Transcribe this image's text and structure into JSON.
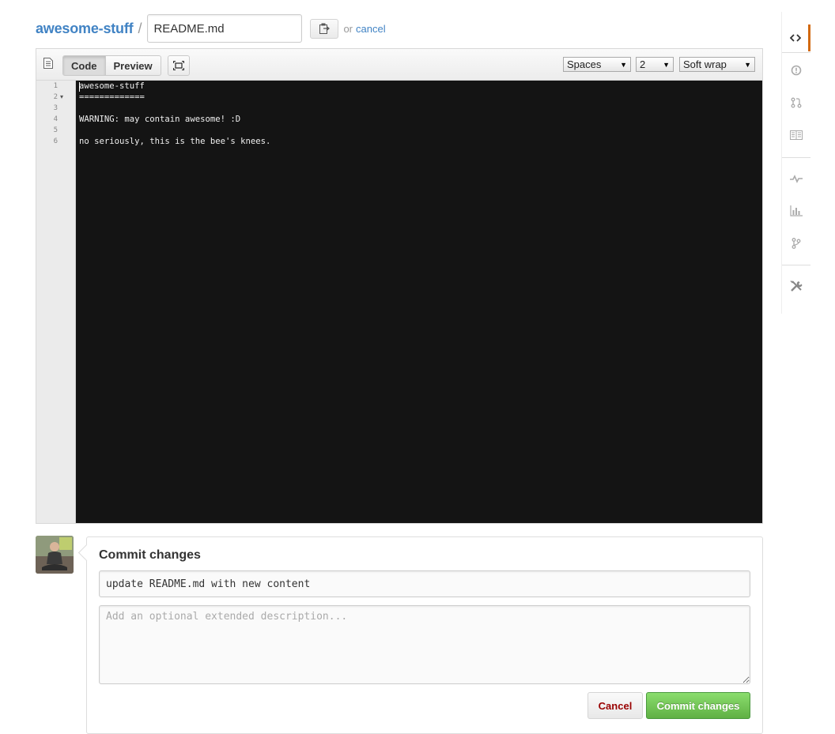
{
  "breadcrumb": {
    "repo_name": "awesome-stuff",
    "separator": "/",
    "filename_value": "README.md",
    "or_text": "or",
    "cancel_link": "cancel"
  },
  "editor": {
    "tabs": [
      {
        "label": "Code",
        "selected": true
      },
      {
        "label": "Preview",
        "selected": false
      }
    ],
    "indent_mode": {
      "selected": "Spaces"
    },
    "indent_size": {
      "selected": "2"
    },
    "wrap_mode": {
      "selected": "Soft wrap"
    },
    "lines": [
      {
        "number": "1",
        "text": "awesome-stuff"
      },
      {
        "number": "2",
        "text": "=============",
        "fold": true
      },
      {
        "number": "3",
        "text": ""
      },
      {
        "number": "4",
        "text": "WARNING: may contain awesome! :D"
      },
      {
        "number": "5",
        "text": ""
      },
      {
        "number": "6",
        "text": "no seriously, this is the bee's knees."
      }
    ]
  },
  "commit": {
    "title": "Commit changes",
    "summary_value": "update README.md with new content",
    "description_placeholder": "Add an optional extended description...",
    "cancel_label": "Cancel",
    "commit_label": "Commit changes"
  },
  "repo_nav": {
    "items": [
      {
        "name": "code-icon",
        "selected": true
      },
      {
        "name": "issues-icon"
      },
      {
        "name": "pull-requests-icon"
      },
      {
        "name": "wiki-icon"
      },
      {
        "name": "pulse-icon"
      },
      {
        "name": "graphs-icon"
      },
      {
        "name": "network-icon"
      },
      {
        "name": "settings-icon"
      }
    ]
  },
  "colors": {
    "link": "#4183c4",
    "editor_background": "#141414",
    "commit_button": "#60b044",
    "cancel_text": "#990000",
    "nav_selected": "#d26911"
  }
}
